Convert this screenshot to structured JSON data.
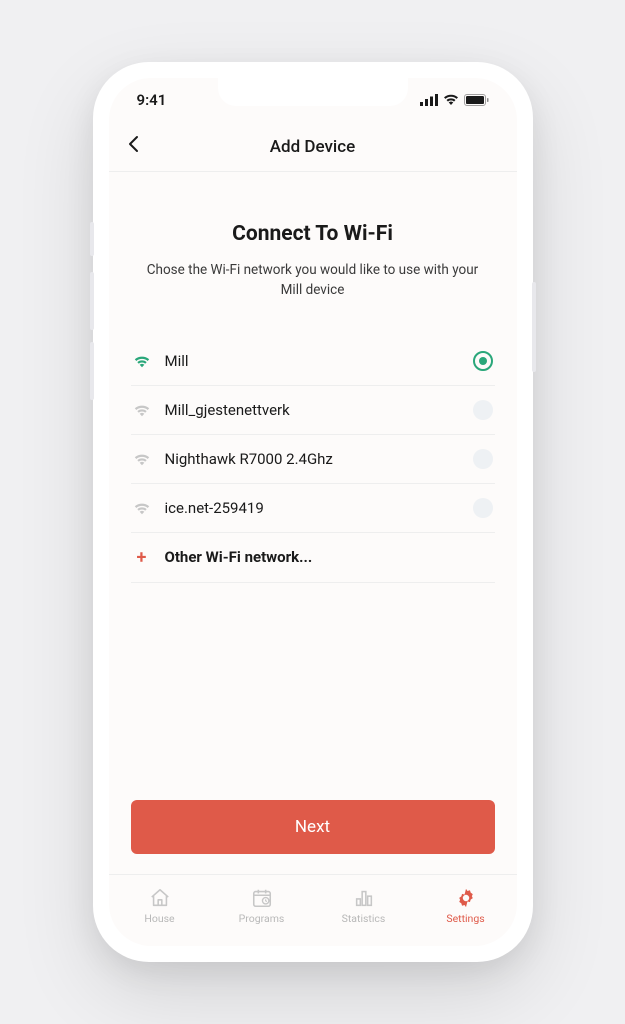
{
  "status": {
    "time": "9:41"
  },
  "header": {
    "title": "Add Device"
  },
  "main": {
    "heading": "Connect To Wi-Fi",
    "subheading": "Chose the Wi-Fi network you would like   to use with your Mill device"
  },
  "networks": [
    {
      "name": "Mill",
      "selected": true
    },
    {
      "name": "Mill_gjestenettverk",
      "selected": false
    },
    {
      "name": "Nighthawk R7000 2.4Ghz",
      "selected": false
    },
    {
      "name": "ice.net-259419",
      "selected": false
    }
  ],
  "other_label": "Other Wi-Fi network...",
  "cta": {
    "next": "Next"
  },
  "tabs": [
    {
      "label": "House",
      "icon": "house",
      "active": false
    },
    {
      "label": "Programs",
      "icon": "calendar",
      "active": false
    },
    {
      "label": "Statistics",
      "icon": "chart",
      "active": false
    },
    {
      "label": "Settings",
      "icon": "gear",
      "active": true
    }
  ],
  "colors": {
    "accent": "#df5a49",
    "success": "#2aa77a"
  }
}
